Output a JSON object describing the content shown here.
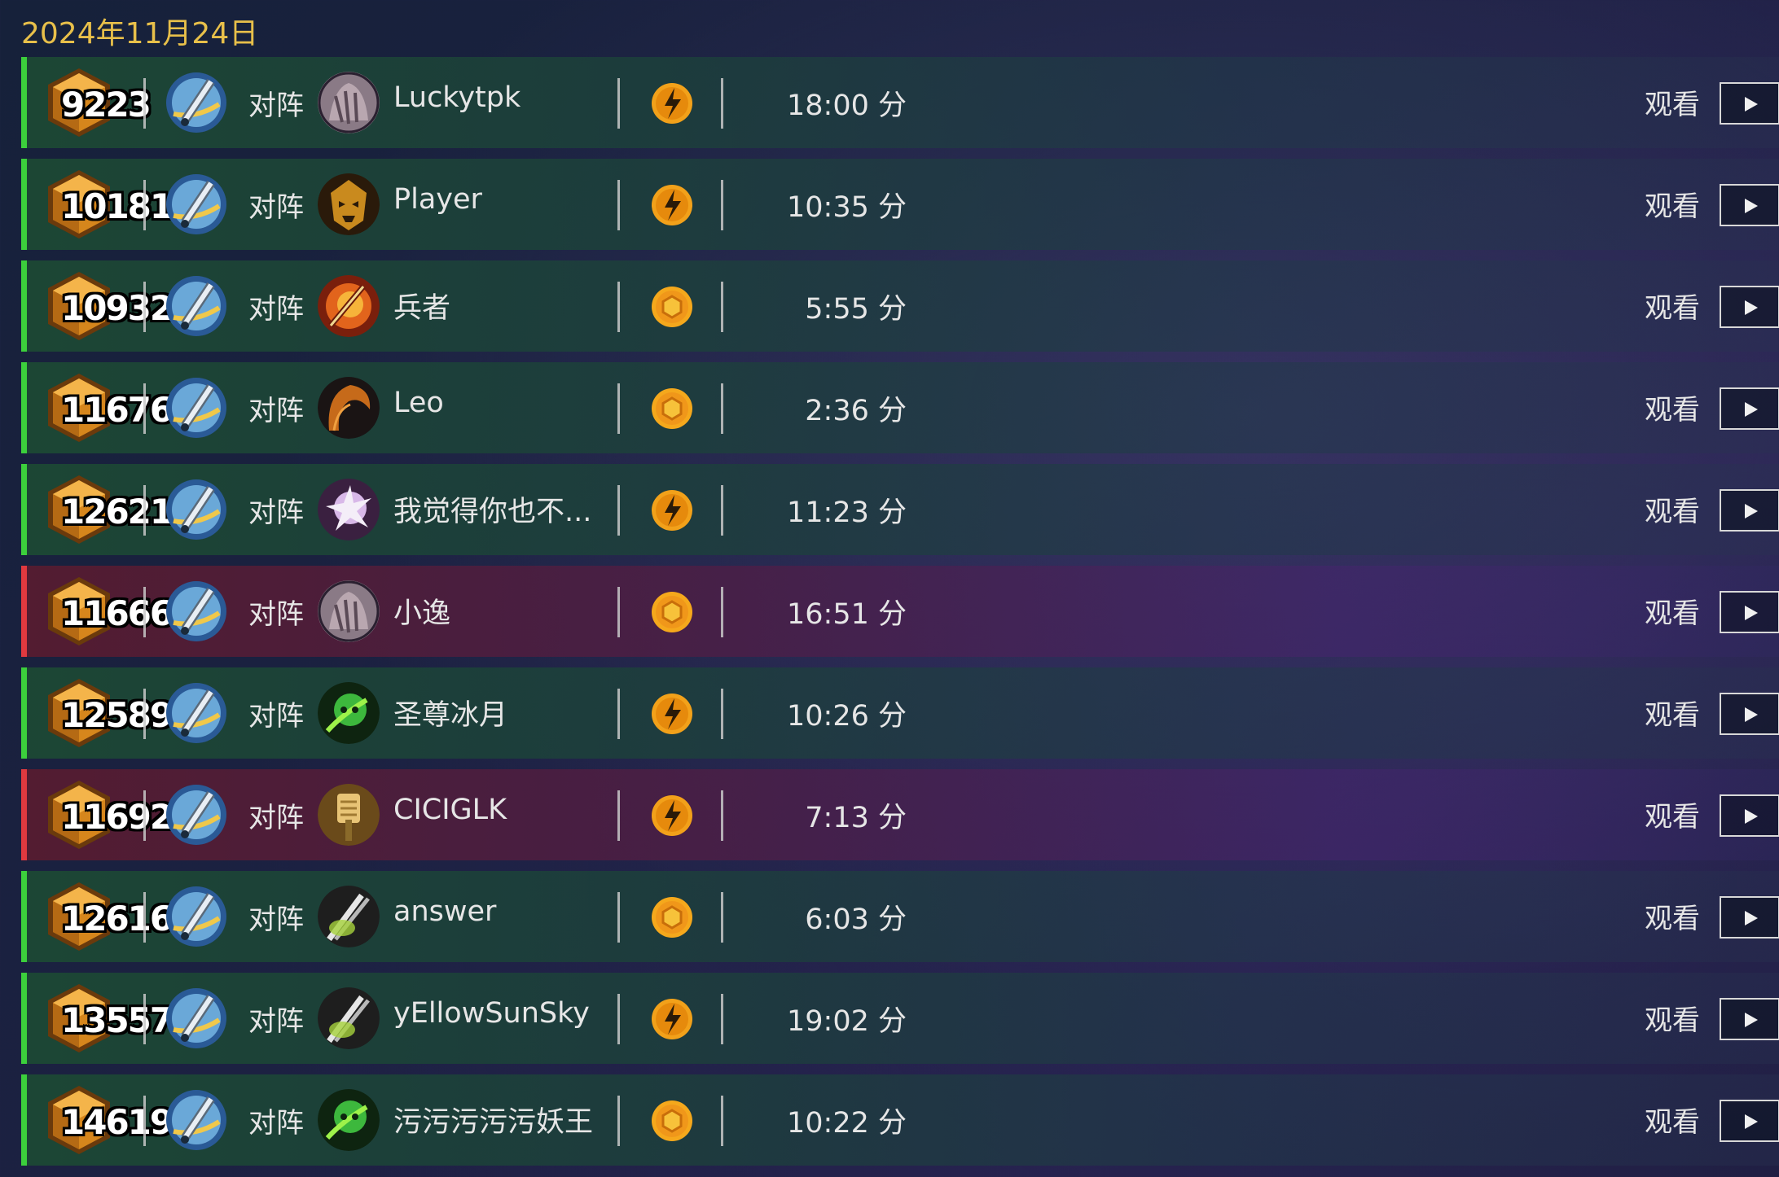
{
  "date": "2024年11月24日",
  "vs_label": "对阵",
  "watch_label": "观看",
  "colors": {
    "win": "#3ccf3c",
    "loss": "#e0393f",
    "accent": "#e8c04a"
  },
  "matches": [
    {
      "mmr": "9223",
      "opponent": "Luckytpk",
      "duration": "18:00 分",
      "result": "win",
      "opp_icon": "ogre-avatar-icon",
      "result_icon": "lightning-badge-icon"
    },
    {
      "mmr": "10181",
      "opponent": "Player",
      "duration": "10:35 分",
      "result": "win",
      "opp_icon": "tribal-mask-avatar-icon",
      "result_icon": "lightning-badge-icon"
    },
    {
      "mmr": "10932",
      "opponent": "兵者",
      "duration": "5:55 分",
      "result": "win",
      "opp_icon": "fire-sword-avatar-icon",
      "result_icon": "hexagon-badge-icon"
    },
    {
      "mmr": "11676",
      "opponent": "Leo",
      "duration": "2:36 分",
      "result": "win",
      "opp_icon": "hooded-avatar-icon",
      "result_icon": "hexagon-badge-icon"
    },
    {
      "mmr": "12621",
      "opponent": "我觉得你也不...",
      "duration": "11:23 分",
      "result": "win",
      "opp_icon": "magic-burst-avatar-icon",
      "result_icon": "lightning-badge-icon"
    },
    {
      "mmr": "11666",
      "opponent": "小逸",
      "duration": "16:51 分",
      "result": "loss",
      "opp_icon": "ogre-avatar-icon",
      "result_icon": "hexagon-badge-icon"
    },
    {
      "mmr": "12589",
      "opponent": "圣尊冰月",
      "duration": "10:26 分",
      "result": "win",
      "opp_icon": "green-skull-avatar-icon",
      "result_icon": "lightning-badge-icon"
    },
    {
      "mmr": "11692",
      "opponent": "CICIGLK",
      "duration": "7:13 分",
      "result": "loss",
      "opp_icon": "golden-hammer-avatar-icon",
      "result_icon": "lightning-badge-icon"
    },
    {
      "mmr": "12616",
      "opponent": "answer",
      "duration": "6:03 分",
      "result": "win",
      "opp_icon": "dual-blades-avatar-icon",
      "result_icon": "hexagon-badge-icon"
    },
    {
      "mmr": "13557",
      "opponent": "yEllowSunSky",
      "duration": "19:02 分",
      "result": "win",
      "opp_icon": "dual-blades-avatar-icon",
      "result_icon": "lightning-badge-icon"
    },
    {
      "mmr": "14619",
      "opponent": "污污污污污妖王",
      "duration": "10:22 分",
      "result": "win",
      "opp_icon": "green-skull-avatar-icon",
      "result_icon": "hexagon-badge-icon"
    }
  ]
}
